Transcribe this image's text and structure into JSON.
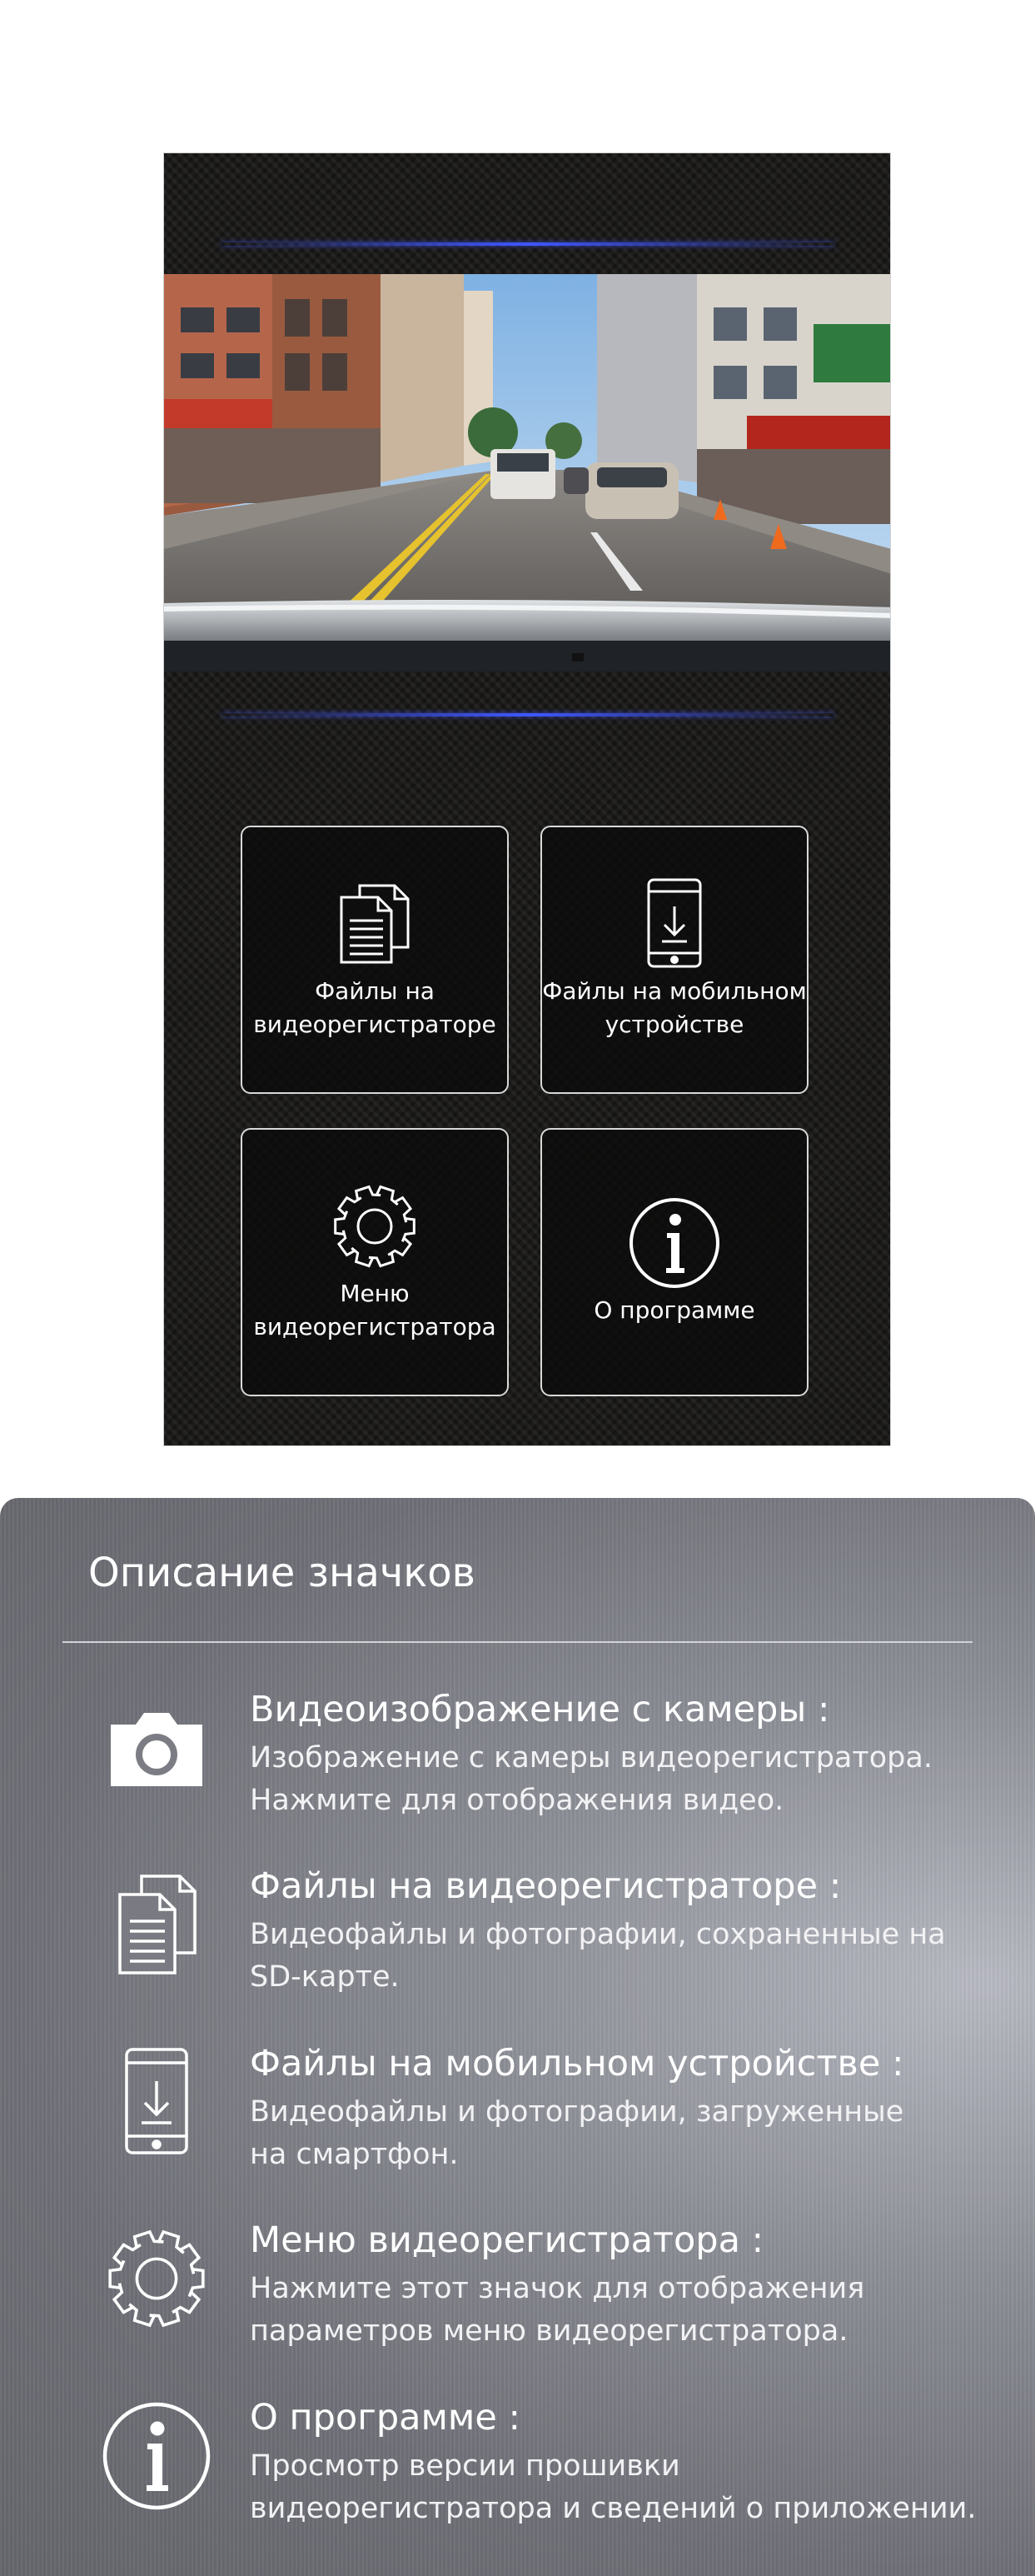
{
  "menu": {
    "tiles": [
      {
        "label": "Файлы на\nвидеорегистраторе",
        "icon": "documents-icon"
      },
      {
        "label": "Файлы на мобильном\nустройстве",
        "icon": "phone-download-icon"
      },
      {
        "label": "Меню\nвидеорегистратора",
        "icon": "gear-icon"
      },
      {
        "label": "О программе",
        "icon": "info-icon"
      }
    ]
  },
  "legend": {
    "title": "Описание значков",
    "items": [
      {
        "icon": "camera-icon",
        "title": "Видеоизображение с камеры :",
        "desc": "Изображение с камеры видеорегистратора.\nНажмите для отображения видео."
      },
      {
        "icon": "documents-icon",
        "title": "Файлы на видеорегистраторе :",
        "desc": "Видеофайлы и фотографии, сохраненные на\nSD-карте."
      },
      {
        "icon": "phone-download-icon",
        "title": "Файлы на мобильном устройстве :",
        "desc": "Видеофайлы и фотографии, загруженные\nна смартфон."
      },
      {
        "icon": "gear-icon",
        "title": "Меню видеорегистратора :",
        "desc": "Нажмите этот значок для отображения\nпараметров меню видеорегистратора."
      },
      {
        "icon": "info-icon",
        "title": "О программе :",
        "desc": "Просмотр версии прошивки\nвидеорегистратора и сведений о приложении."
      }
    ]
  }
}
